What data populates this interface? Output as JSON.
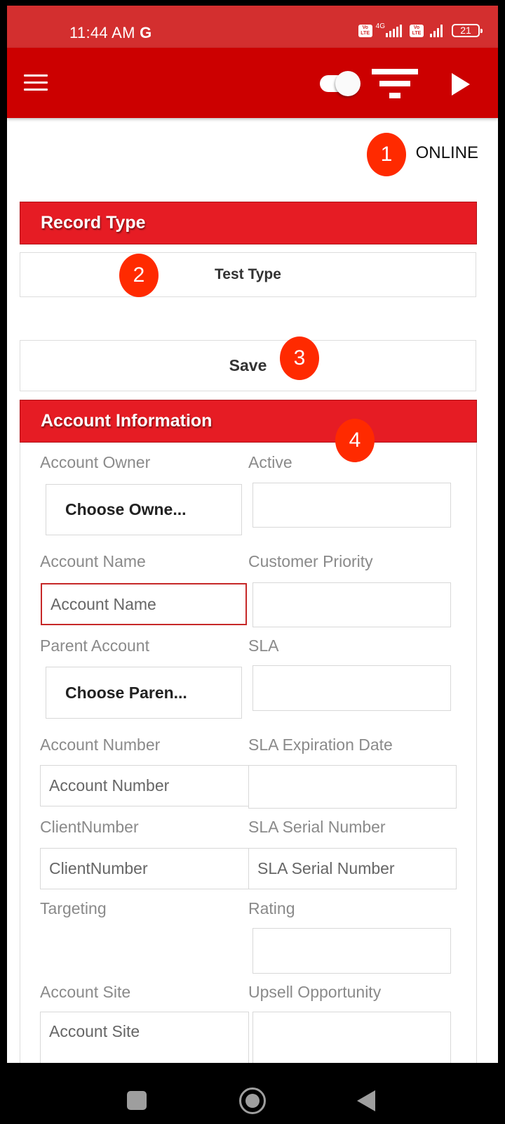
{
  "status_bar": {
    "time": "11:44 AM",
    "carrier_glyph": "G",
    "sim1_volte": "Vo LTE",
    "sim1_network": "4G",
    "sim2_volte": "Vo LTE",
    "battery_level": "21",
    "icons": [
      "volte-icon",
      "signal-4g-icon",
      "volte-icon",
      "signal-icon",
      "battery-icon"
    ]
  },
  "app_bar": {
    "icons": [
      "hamburger-menu-icon",
      "toggle-switch",
      "filter-icon",
      "play-icon"
    ],
    "colors": {
      "background": "#cc0000",
      "status_bar": "#d32f2f"
    }
  },
  "connection_status": "ONLINE",
  "annotations": [
    "1",
    "2",
    "3",
    "4"
  ],
  "record_type": {
    "header": "Record Type",
    "value": "Test Type"
  },
  "save_label": "Save",
  "account_information": {
    "header": "Account Information",
    "header_color": "#e61c24",
    "fields": {
      "account_owner": {
        "label": "Account Owner",
        "value": "Choose Owne..."
      },
      "active": {
        "label": "Active",
        "value": ""
      },
      "account_name": {
        "label": "Account Name",
        "placeholder": "Account Name"
      },
      "customer_priority": {
        "label": "Customer Priority",
        "value": ""
      },
      "parent_account": {
        "label": "Parent Account",
        "value": "Choose Paren..."
      },
      "sla": {
        "label": "SLA",
        "value": ""
      },
      "account_number": {
        "label": "Account Number",
        "placeholder": "Account Number"
      },
      "sla_expiration_date": {
        "label": "SLA Expiration Date",
        "value": ""
      },
      "client_number": {
        "label": "ClientNumber",
        "placeholder": "ClientNumber"
      },
      "sla_serial_number": {
        "label": "SLA Serial Number",
        "placeholder": "SLA Serial Number"
      },
      "targeting": {
        "label": "Targeting"
      },
      "rating": {
        "label": "Rating",
        "value": ""
      },
      "account_site": {
        "label": "Account Site",
        "placeholder": "Account Site"
      },
      "upsell_opportunity": {
        "label": "Upsell Opportunity",
        "value": ""
      }
    }
  },
  "nav_bar": {
    "icons": [
      "recents-square-icon",
      "home-circle-icon",
      "back-triangle-icon"
    ]
  }
}
